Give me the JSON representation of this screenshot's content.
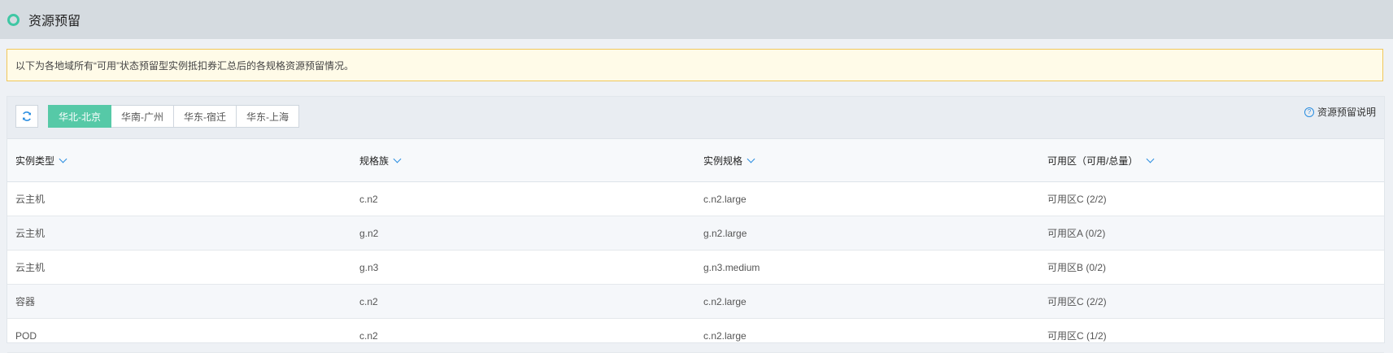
{
  "page": {
    "title": "资源预留"
  },
  "notice": {
    "text": "以下为各地域所有“可用”状态预留型实例抵扣券汇总后的各规格资源预留情况。"
  },
  "toolbar": {
    "regions": [
      {
        "label": "华北-北京",
        "active": true
      },
      {
        "label": "华南-广州",
        "active": false
      },
      {
        "label": "华东-宿迁",
        "active": false
      },
      {
        "label": "华东-上海",
        "active": false
      }
    ],
    "help_label": "资源预留说明"
  },
  "table": {
    "headers": [
      "实例类型",
      "规格族",
      "实例规格",
      "可用区（可用/总量）"
    ],
    "rows": [
      [
        "云主机",
        "c.n2",
        "c.n2.large",
        "可用区C (2/2)"
      ],
      [
        "云主机",
        "g.n2",
        "g.n2.large",
        "可用区A (0/2)"
      ],
      [
        "云主机",
        "g.n3",
        "g.n3.medium",
        "可用区B (0/2)"
      ],
      [
        "容器",
        "c.n2",
        "c.n2.large",
        "可用区C (2/2)"
      ],
      [
        "POD",
        "c.n2",
        "c.n2.large",
        "可用区C (1/2)"
      ]
    ]
  },
  "colors": {
    "accent": "#56c9a7",
    "link": "#2a8de0",
    "header_bg": "#d5dbe0"
  }
}
